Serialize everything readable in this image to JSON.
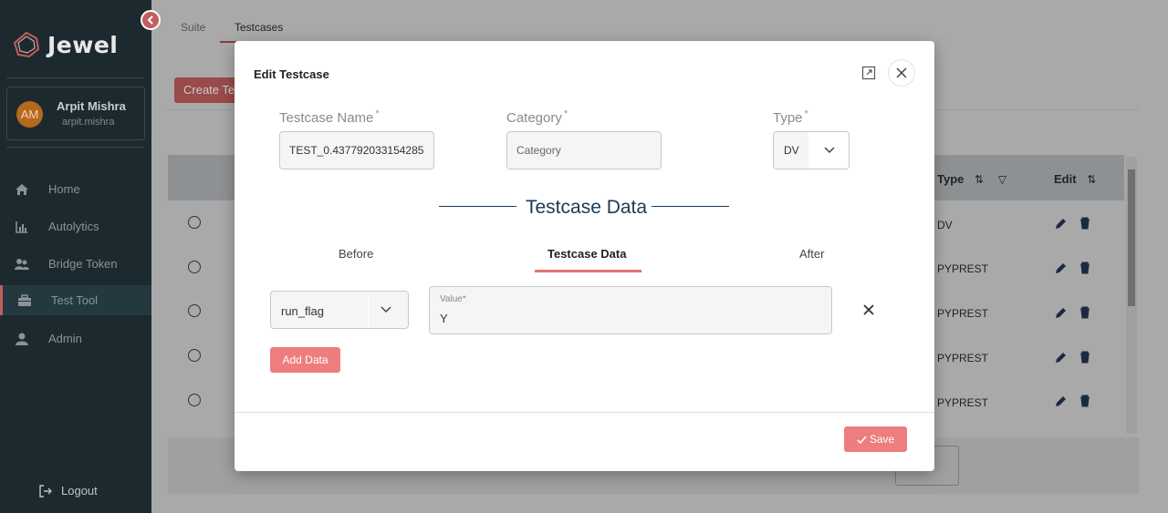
{
  "app": {
    "name": "Jewel"
  },
  "user": {
    "initials": "AM",
    "name": "Arpit Mishra",
    "email": "arpit.mishra"
  },
  "sidebar": {
    "items": [
      {
        "label": "Home",
        "icon": "home-icon"
      },
      {
        "label": "Autolytics",
        "icon": "chart-icon"
      },
      {
        "label": "Bridge Token",
        "icon": "users-icon"
      },
      {
        "label": "Test Tool",
        "icon": "toolbox-icon"
      },
      {
        "label": "Admin",
        "icon": "user-icon"
      }
    ],
    "active": "Test Tool",
    "logout_label": "Logout"
  },
  "background": {
    "tabs": [
      "Suite",
      "Testcases"
    ],
    "active_tab": "Testcases",
    "create_button": "Create Te",
    "columns": {
      "type": "Type",
      "edit": "Edit"
    },
    "row_types": [
      "DV",
      "PYPREST",
      "PYPREST",
      "PYPREST",
      "PYPREST"
    ]
  },
  "modal": {
    "title": "Edit Testcase",
    "fields": {
      "testcase_name": {
        "label": "Testcase Name",
        "value": "TEST_0.437792033154285"
      },
      "category": {
        "label": "Category",
        "placeholder": "Category"
      },
      "type": {
        "label": "Type",
        "value": "DV"
      }
    },
    "required_mark": "*",
    "section_title": "Testcase Data",
    "tabs": [
      "Before",
      "Testcase Data",
      "After"
    ],
    "active_tab": "Testcase Data",
    "data_row": {
      "key": "run_flag",
      "value_label": "Value*",
      "value": "Y"
    },
    "add_data_label": "Add Data",
    "save_label": "Save"
  },
  "colors": {
    "accent": "#ee7d7d",
    "sidebar_bg": "#1c2a30",
    "heading": "#1b3a57"
  }
}
